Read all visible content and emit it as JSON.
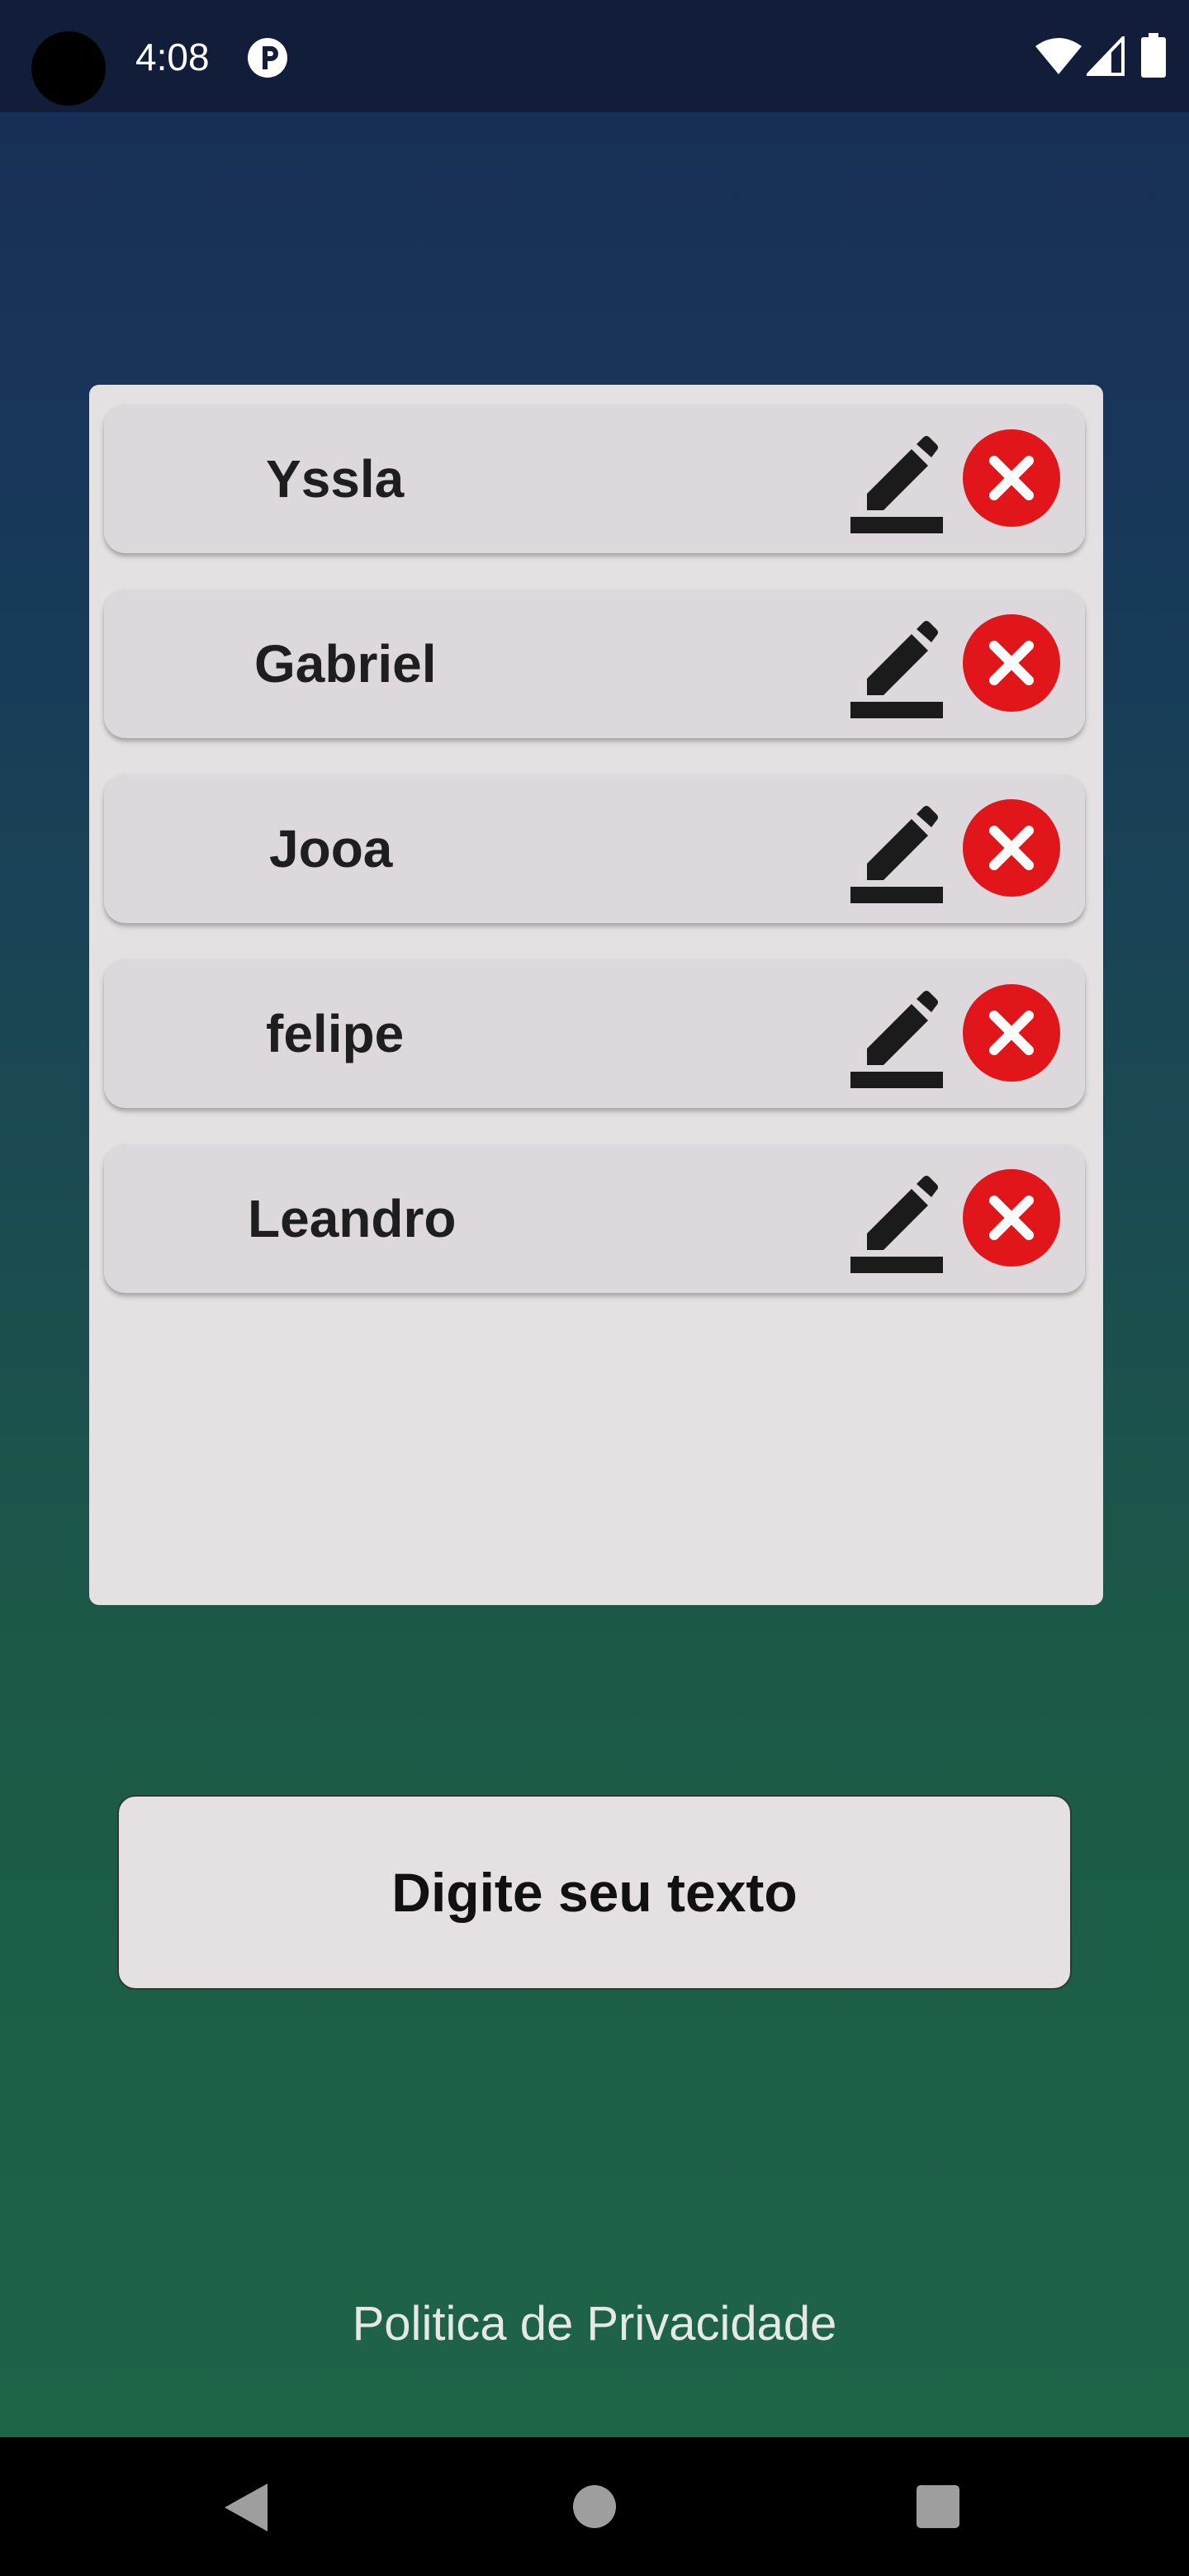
{
  "status_bar": {
    "time": "4:08",
    "icons": [
      "camera-cutout",
      "app-notification-icon",
      "wifi-icon",
      "signal-icon",
      "battery-icon"
    ]
  },
  "list": {
    "items": [
      {
        "name": "Yssla",
        "edit_icon": "pencil-edit-icon",
        "delete_icon": "close-circle-icon"
      },
      {
        "name": "Gabriel",
        "edit_icon": "pencil-edit-icon",
        "delete_icon": "close-circle-icon"
      },
      {
        "name": "Jooa",
        "edit_icon": "pencil-edit-icon",
        "delete_icon": "close-circle-icon"
      },
      {
        "name": "felipe",
        "edit_icon": "pencil-edit-icon",
        "delete_icon": "close-circle-icon"
      },
      {
        "name": "Leandro",
        "edit_icon": "pencil-edit-icon",
        "delete_icon": "close-circle-icon"
      }
    ]
  },
  "input_button": {
    "label": "Digite seu texto"
  },
  "footer": {
    "privacy_link": "Politica de Privacidade"
  },
  "nav_bar": {
    "icons": [
      "back-icon",
      "home-icon",
      "recents-icon"
    ]
  },
  "colors": {
    "gradient_top": "#172c55",
    "gradient_bottom": "#1e6647",
    "panel": "#e5e0e1",
    "row": "#dcd8db",
    "delete": "#e0161b",
    "text_dark": "#1e1e1e"
  }
}
